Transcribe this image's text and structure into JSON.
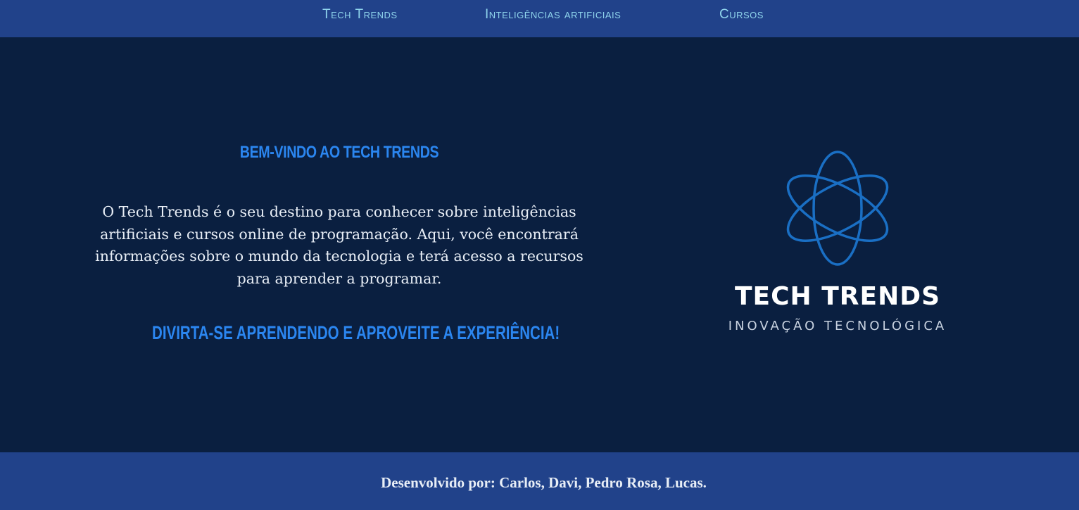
{
  "nav": {
    "items": [
      {
        "label": "Tech Trends"
      },
      {
        "label": "Inteligências artificiais"
      },
      {
        "label": "Cursos"
      }
    ]
  },
  "hero": {
    "heading": "Bem-vindo ao Tech Trends",
    "intro": "O Tech Trends é o seu destino para conhecer sobre inteligências artificiais e cursos online de programação. Aqui, você encontrará informações sobre o mundo da tecnologia e terá acesso a recursos para aprender a programar.",
    "cta": "Divirta-se aprendendo e aproveite a experiência!"
  },
  "logo": {
    "icon": "atom-icon",
    "title": "TECH TRENDS",
    "subtitle": "Inovação Tecnológica"
  },
  "footer": {
    "text": "Desenvolvido por: Carlos, Davi, Pedro Rosa, Lucas."
  },
  "colors": {
    "nav_background": "#21428a",
    "page_background": "#0a1f40",
    "accent_blue": "#2b86f0",
    "nav_link": "#8fd4ec",
    "atom_stroke": "#1a6fc4"
  }
}
